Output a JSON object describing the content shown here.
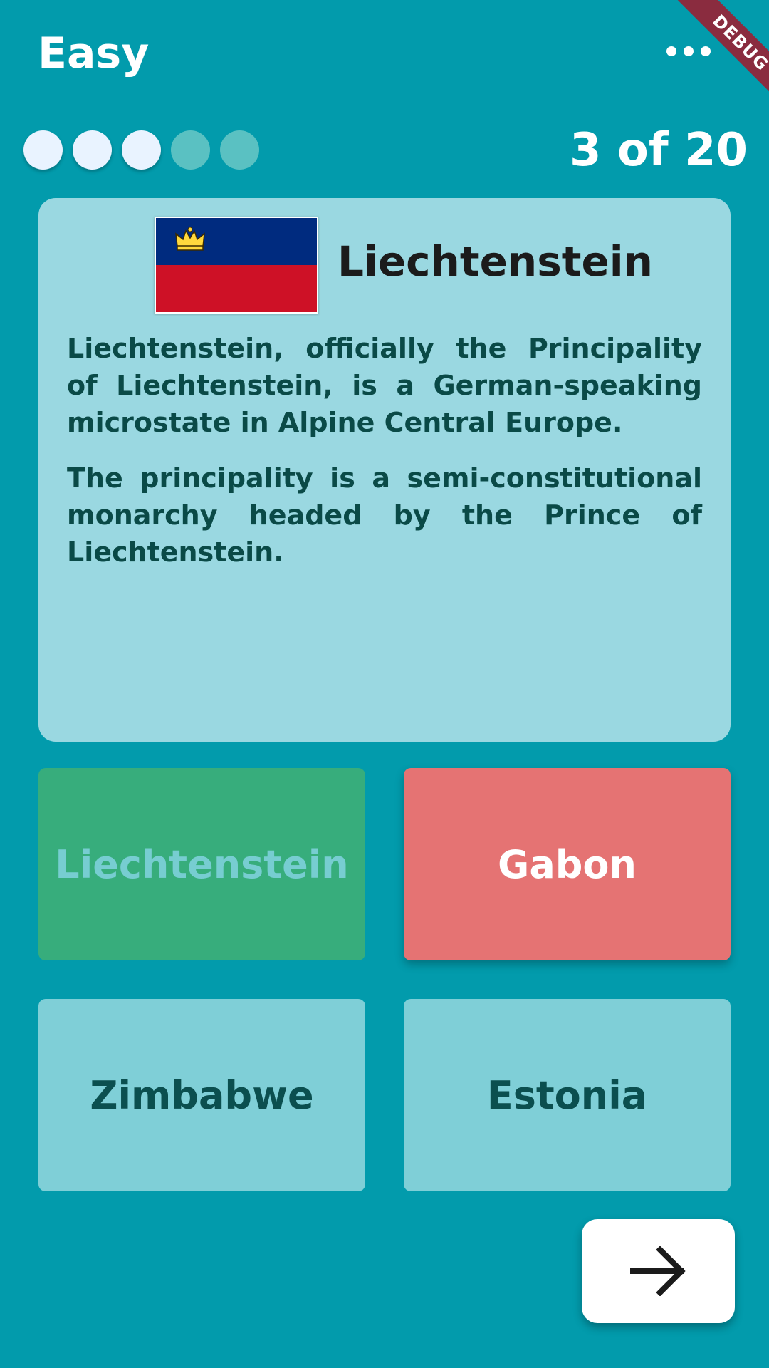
{
  "app_bar": {
    "title": "Easy",
    "menu_icon": "more-horizontal-icon",
    "debug_label": "DEBUG"
  },
  "progress": {
    "counter": "3 of 20",
    "dots": [
      {
        "state": "done"
      },
      {
        "state": "done"
      },
      {
        "state": "done"
      },
      {
        "state": "pending"
      },
      {
        "state": "pending"
      }
    ]
  },
  "question": {
    "country": "Liechtenstein",
    "flag_icon": "liechtenstein-flag-icon",
    "description": [
      "Liechtenstein, officially the Principality of Liechtenstein, is a German-speaking microstate in Alpine Central Europe.",
      "The principality is a semi-constitutional monarchy headed by the Prince of Liechtenstein."
    ]
  },
  "answers": [
    {
      "label": "Liechtenstein",
      "state": "correct"
    },
    {
      "label": "Gabon",
      "state": "wrong"
    },
    {
      "label": "Zimbabwe",
      "state": "neutral"
    },
    {
      "label": "Estonia",
      "state": "neutral"
    }
  ],
  "next_button": {
    "icon": "arrow-right-icon"
  },
  "colors": {
    "background": "#029bac",
    "card": "#9ad8e1",
    "correct": "#37ad7c",
    "wrong": "#e57373",
    "neutral": "#7fcfd7"
  }
}
